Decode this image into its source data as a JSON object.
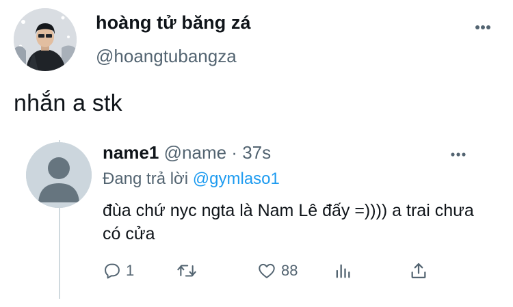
{
  "main_tweet": {
    "author_name": "hoàng tử băng zá",
    "author_handle": "@hoangtubangza",
    "text": "nhắn a stk",
    "more_icon": "more-horizontal-icon"
  },
  "reply_tweet": {
    "author_name": "name1",
    "author_handle": "@name",
    "separator": "·",
    "time": "37s",
    "replying_prefix": "Đang trả lời",
    "replying_to": "@gymlaso1",
    "text": "đùa chứ nyc ngta là Nam Lê đấy =)))) a trai chưa có cửa",
    "actions": {
      "reply_count": "1",
      "retweet_count": "",
      "like_count": "88"
    },
    "more_icon": "more-horizontal-icon"
  },
  "colors": {
    "text": "#0f1419",
    "muted": "#536471",
    "link": "#1d9bf0",
    "thread_line": "#cfd9de",
    "avatar_placeholder": "#ccd6dd"
  }
}
